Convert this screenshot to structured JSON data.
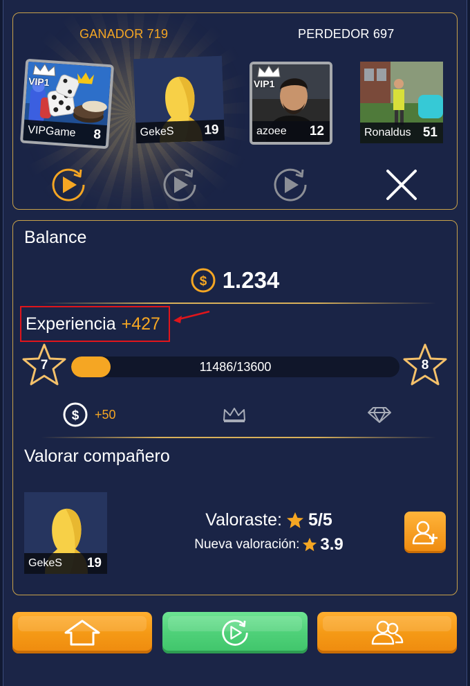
{
  "header": {
    "winner_label": "GANADOR 719",
    "loser_label": "PERDEDOR 697"
  },
  "players": [
    {
      "name": "VIPGame",
      "level": "8",
      "vip": "VIP1",
      "team": "winner"
    },
    {
      "name": "GekeS",
      "level": "19",
      "vip": "",
      "team": "winner"
    },
    {
      "name": "azoee",
      "level": "12",
      "vip": "VIP1",
      "team": "loser"
    },
    {
      "name": "Ronaldus",
      "level": "51",
      "vip": "",
      "team": "loser"
    }
  ],
  "balance": {
    "title": "Balance",
    "value": "1.234",
    "currency_icon": "coin-icon"
  },
  "experience": {
    "label": "Experiencia",
    "gain": "+427",
    "current_level": "7",
    "next_level": "8",
    "progress_text": "11486/13600",
    "progress_fraction": 0.12
  },
  "rewards": {
    "coins": "+50",
    "crown_icon": "crown-icon",
    "diamond_icon": "diamond-icon"
  },
  "rating": {
    "title": "Valorar compañero",
    "player_name": "GekeS",
    "player_level": "19",
    "rated_label": "Valoraste:",
    "rated_value": "5/5",
    "new_rating_label": "Nueva valoración:",
    "new_rating_value": "3.9"
  },
  "colors": {
    "accent_orange": "#f5a623",
    "button_green": "#4fd179",
    "highlight_red": "#e0151b",
    "panel_border": "#c9a24a"
  }
}
